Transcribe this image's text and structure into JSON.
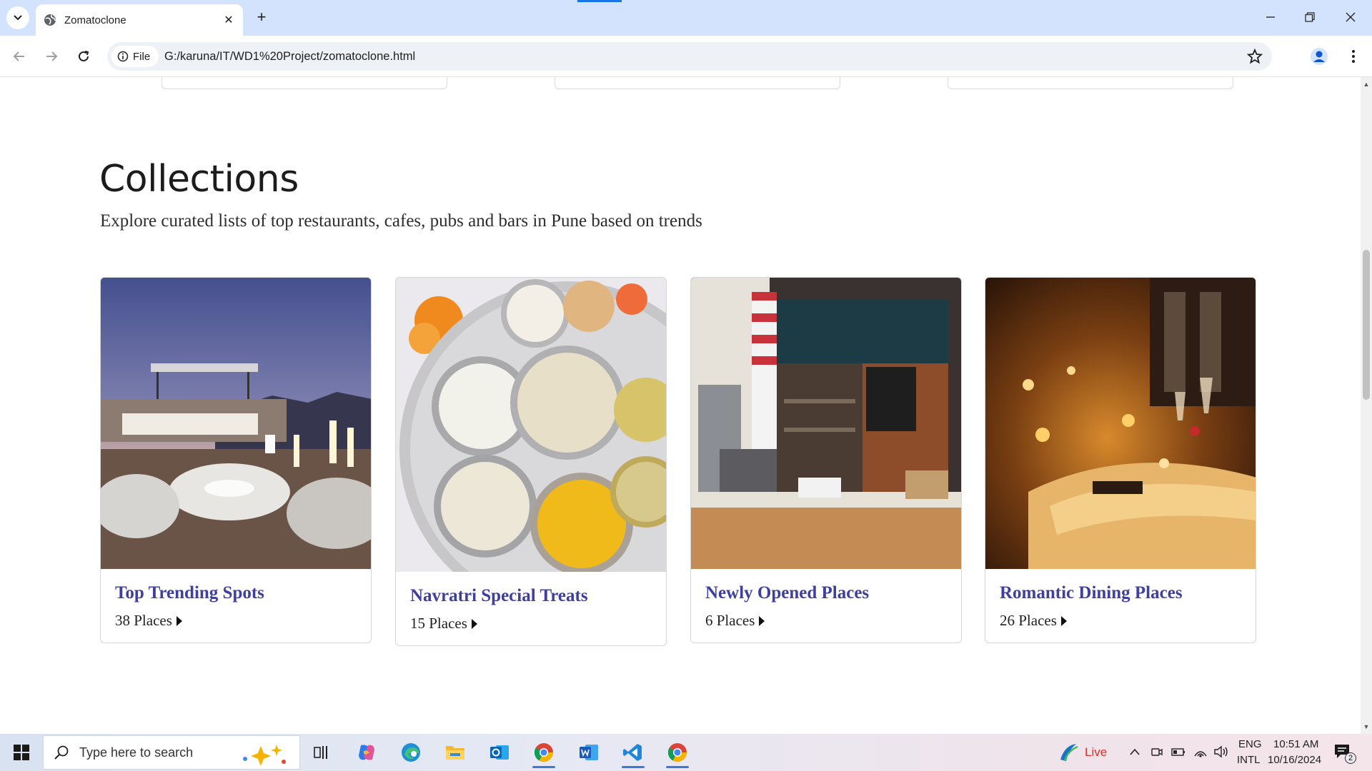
{
  "browser": {
    "tab_title": "Zomatoclone",
    "tab_close": "✕",
    "new_tab": "+",
    "security_chip": "File",
    "url": "G:/karuna/IT/WD1%20Project/zomatoclone.html"
  },
  "page": {
    "section_title": "Collections",
    "section_subtitle": "Explore curated lists of top restaurants, cafes, pubs and bars in Pune based on trends",
    "cards": [
      {
        "title": "Top Trending Spots",
        "count": "38 Places"
      },
      {
        "title": "Navratri Special Treats",
        "count": "15 Places"
      },
      {
        "title": "Newly Opened Places",
        "count": "6 Places"
      },
      {
        "title": "Romantic Dining Places",
        "count": "26 Places"
      }
    ],
    "link_color": "#3f3f9d"
  },
  "taskbar": {
    "search_placeholder": "Type here to search",
    "live_label": "Live",
    "lang_top": "ENG",
    "lang_bottom": "INTL",
    "time": "10:51 AM",
    "date": "10/16/2024",
    "notification_count": "2"
  }
}
